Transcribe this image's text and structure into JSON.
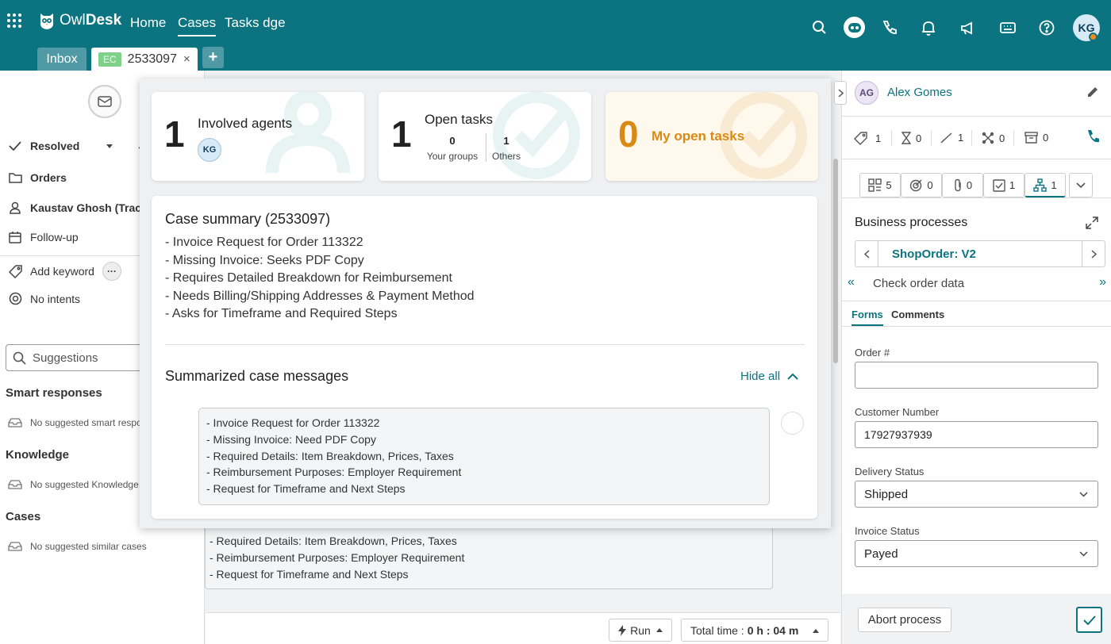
{
  "header": {
    "brand_a": "Owl",
    "brand_b": "Desk",
    "nav": [
      "Home",
      "Cases",
      "Tasks dge"
    ],
    "active_nav": "Cases",
    "user_initials": "KG"
  },
  "tabs": {
    "inbox": "Inbox",
    "case_badge": "EC",
    "case_number": "2533097",
    "close_glyph": "×",
    "add_glyph": "+"
  },
  "left": {
    "status": "Resolved",
    "folder": "Orders",
    "assignee": "Kaustav Ghosh (Tracki",
    "followup": "Follow-up",
    "add_keyword": "Add keyword",
    "more_glyph": "···",
    "intents": "No intents",
    "suggestions_placeholder": "Suggestions",
    "smart_responses": {
      "title": "Smart responses",
      "empty": "No suggested smart respo"
    },
    "knowledge": {
      "title": "Knowledge",
      "empty": "No suggested Knowledge"
    },
    "cases": {
      "title": "Cases",
      "empty": "No suggested similar cases"
    }
  },
  "overlay": {
    "involved": {
      "count": "1",
      "label": "Involved agents",
      "agent": "KG"
    },
    "open_tasks": {
      "count": "1",
      "label": "Open tasks",
      "groups_count": "0",
      "groups_label": "Your groups",
      "others_count": "1",
      "others_label": "Others"
    },
    "my_open": {
      "count": "0",
      "label": "My open tasks"
    },
    "summary_title": "Case summary (2533097)",
    "summary": [
      "- Invoice Request for Order 113322",
      "- Missing Invoice: Seeks PDF Copy",
      "- Requires Detailed Breakdown for Reimbursement",
      "- Needs Billing/Shipping Addresses & Payment Method",
      "- Asks for Timeframe and Required Steps"
    ],
    "messages_title": "Summarized case messages",
    "hide_all": "Hide all",
    "message": [
      "- Invoice Request for Order 113322",
      "- Missing Invoice: Need PDF Copy",
      "- Required Details: Item Breakdown, Prices, Taxes",
      "- Reimbursement Purposes: Employer Requirement",
      "- Request for Timeframe and Next Steps"
    ]
  },
  "background_message": [
    "- Required Details: Item Breakdown, Prices, Taxes",
    "- Reimbursement Purposes: Employer Requirement",
    "- Request for Timeframe and Next Steps"
  ],
  "footer": {
    "run": "Run",
    "time_label": "Total time :",
    "time_value": "0 h : 04 m"
  },
  "right": {
    "contact_initials": "AG",
    "contact_name": "Alex Gomes",
    "stats": [
      "1",
      "0",
      "1",
      "0",
      "0"
    ],
    "tabs": [
      "5",
      "0",
      "0",
      "1",
      "1"
    ],
    "bp_title": "Business processes",
    "process_name": "ShopOrder: V2",
    "step": "Check order data",
    "step_prev": "«",
    "step_next": "»",
    "form_tabs": [
      "Forms",
      "Comments"
    ],
    "fields": {
      "order_label": "Order #",
      "order_value": "",
      "customer_label": "Customer Number",
      "customer_value": "17927937939",
      "delivery_label": "Delivery Status",
      "delivery_value": "Shipped",
      "invoice_label": "Invoice Status",
      "invoice_value": "Payed"
    },
    "abort": "Abort process"
  },
  "colors": {
    "brand": "#0b7480",
    "accent_orange": "#d98a14",
    "ec_badge": "#7fd18a"
  }
}
